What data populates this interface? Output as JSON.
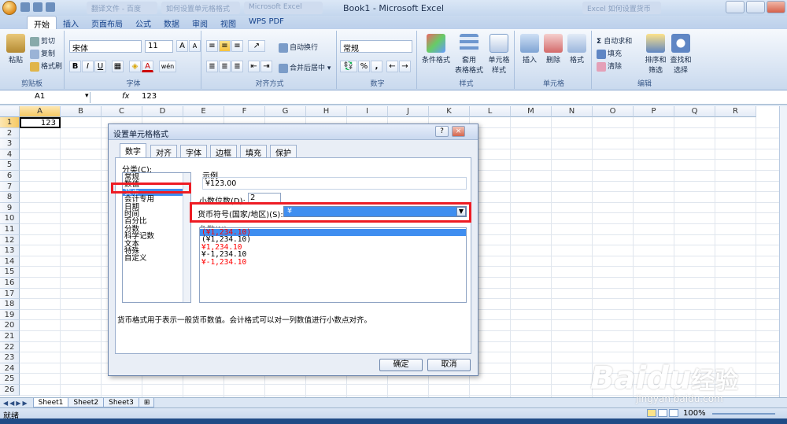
{
  "window": {
    "title": "Book1 - Microsoft Excel",
    "blurred_tabs": [
      "翻译文件 - 百度",
      "如何设置单元格格式",
      "Microsoft Excel",
      "Excel 如何设置货币"
    ]
  },
  "ribbon_tabs": [
    "开始",
    "插入",
    "页面布局",
    "公式",
    "数据",
    "审阅",
    "视图",
    "WPS PDF"
  ],
  "ribbon": {
    "clipboard": {
      "paste": "粘贴",
      "cut": "剪切",
      "copy": "复制",
      "format_painter": "格式刷",
      "label": "剪贴板"
    },
    "font": {
      "name": "宋体",
      "size": "11",
      "grow": "A",
      "shrink": "A",
      "bold": "B",
      "italic": "I",
      "underline": "U",
      "color": "A",
      "wen": "wén",
      "label": "字体"
    },
    "alignment": {
      "wrap": "自动换行",
      "merge": "合并后居中",
      "label": "对齐方式"
    },
    "number": {
      "format": "常规",
      "percent": "%",
      "comma": ",",
      "label": "数字"
    },
    "styles": {
      "conditional": "条件格式",
      "table": "套用",
      "table2": "表格格式",
      "cell": "单元格",
      "cell2": "样式",
      "label": "样式"
    },
    "cells": {
      "insert": "插入",
      "delete": "删除",
      "format": "格式",
      "label": "单元格"
    },
    "editing": {
      "autosum": "自动求和",
      "fill": "填充",
      "clear": "清除",
      "sort": "排序和",
      "sort2": "筛选",
      "find": "查找和",
      "find2": "选择",
      "label": "编辑"
    }
  },
  "formula_bar": {
    "name_box": "A1",
    "fx": "fx",
    "value": "123"
  },
  "columns": [
    "A",
    "B",
    "C",
    "D",
    "E",
    "F",
    "G",
    "H",
    "I",
    "J",
    "K",
    "L",
    "M",
    "N",
    "O",
    "P",
    "Q",
    "R"
  ],
  "rows": [
    "1",
    "2",
    "3",
    "4",
    "5",
    "6",
    "7",
    "8",
    "9",
    "10",
    "11",
    "12",
    "13",
    "14",
    "15",
    "16",
    "17",
    "18",
    "19",
    "20",
    "21",
    "22",
    "23",
    "24",
    "25",
    "26"
  ],
  "cells": {
    "A1": "123"
  },
  "sheets": [
    "Sheet1",
    "Sheet2",
    "Sheet3"
  ],
  "status": {
    "ready": "就绪",
    "zoom": "100%"
  },
  "dialog": {
    "title": "设置单元格格式",
    "help": "?",
    "close": "×",
    "tabs": [
      "数字",
      "对齐",
      "字体",
      "边框",
      "填充",
      "保护"
    ],
    "category_label": "分类(C):",
    "categories": [
      "常规",
      "数值",
      "货币",
      "会计专用",
      "日期",
      "时间",
      "百分比",
      "分数",
      "科学记数",
      "文本",
      "特殊",
      "自定义"
    ],
    "selected_category": "货币",
    "sample_label": "示例",
    "sample_value": "¥123.00",
    "decimal_label": "小数位数(D):",
    "decimal_value": "2",
    "symbol_label": "货币符号(国家/地区)(S):",
    "symbol_value": "¥",
    "negative_label": "负数(N):",
    "negatives": [
      {
        "text": "(¥1,234.10)",
        "color": "#ff0000",
        "selected": true
      },
      {
        "text": "(¥1,234.10)",
        "color": "#000000",
        "selected": false
      },
      {
        "text": "¥1,234.10",
        "color": "#ff0000",
        "selected": false
      },
      {
        "text": "¥-1,234.10",
        "color": "#000000",
        "selected": false
      },
      {
        "text": "¥-1,234.10",
        "color": "#ff0000",
        "selected": false
      }
    ],
    "description": "货币格式用于表示一般货币数值。会计格式可以对一列数值进行小数点对齐。",
    "ok": "确定",
    "cancel": "取消"
  },
  "watermark": {
    "brand": "Bai",
    "paw": "du",
    "jingyan": "经验",
    "url": "jingyan.baidu.com"
  },
  "colors": {
    "selection": "#3f8ef0",
    "highlight": "#ee1c24",
    "ribbon_text": "#15428b"
  }
}
